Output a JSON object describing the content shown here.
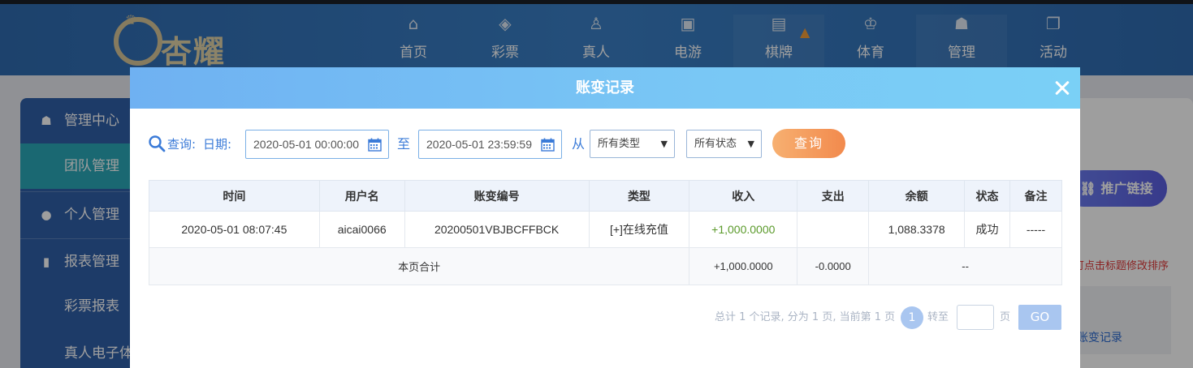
{
  "background": {
    "logo_text": "杏耀",
    "nav": [
      {
        "label": "首页",
        "icon": "home-icon"
      },
      {
        "label": "彩票",
        "icon": "lottery-ticket-icon"
      },
      {
        "label": "真人",
        "icon": "dealer-icon"
      },
      {
        "label": "电游",
        "icon": "slot-machine-icon"
      },
      {
        "label": "棋牌",
        "icon": "cards-icon"
      },
      {
        "label": "体育",
        "icon": "trophy-icon"
      },
      {
        "label": "管理",
        "icon": "users-icon"
      },
      {
        "label": "活动",
        "icon": "gift-icon"
      }
    ],
    "sidebar": [
      {
        "label": "管理中心",
        "icon": "users-icon"
      },
      {
        "label": "团队管理"
      },
      {
        "label": "个人管理",
        "icon": "user-icon"
      },
      {
        "label": "报表管理",
        "icon": "report-icon"
      },
      {
        "label": "彩票报表"
      },
      {
        "label": "真人电子体"
      }
    ],
    "promo_button": "推广链接",
    "sort_tip": "可点击标题修改排序",
    "ledger_link": "账变记录"
  },
  "modal": {
    "title": "账变记录",
    "filters": {
      "query_label": "查询:",
      "date_label": "日期:",
      "start": "2020-05-01 00:00:00",
      "to_label": "至",
      "end": "2020-05-01 23:59:59",
      "from_label": "从",
      "type_select": "所有类型",
      "status_select": "所有状态",
      "query_button": "查询"
    },
    "table": {
      "headers": [
        "时间",
        "用户名",
        "账变编号",
        "类型",
        "收入",
        "支出",
        "余额",
        "状态",
        "备注"
      ],
      "rows": [
        [
          "2020-05-01 08:07:45",
          "aicai0066",
          "20200501VBJBCFFBCK",
          "[+]在线充值",
          "+1,000.0000",
          "",
          "1,088.3378",
          "成功",
          "-----"
        ]
      ],
      "summary": {
        "label": "本页合计",
        "income": "+1,000.0000",
        "expense": "-0.0000",
        "rest": "--"
      }
    },
    "pagination": {
      "info": "总计 1 个记录, 分为 1 页, 当前第 1 页",
      "current": "1",
      "goto_label": "转至",
      "page_suffix": "页",
      "go_button": "GO"
    }
  }
}
